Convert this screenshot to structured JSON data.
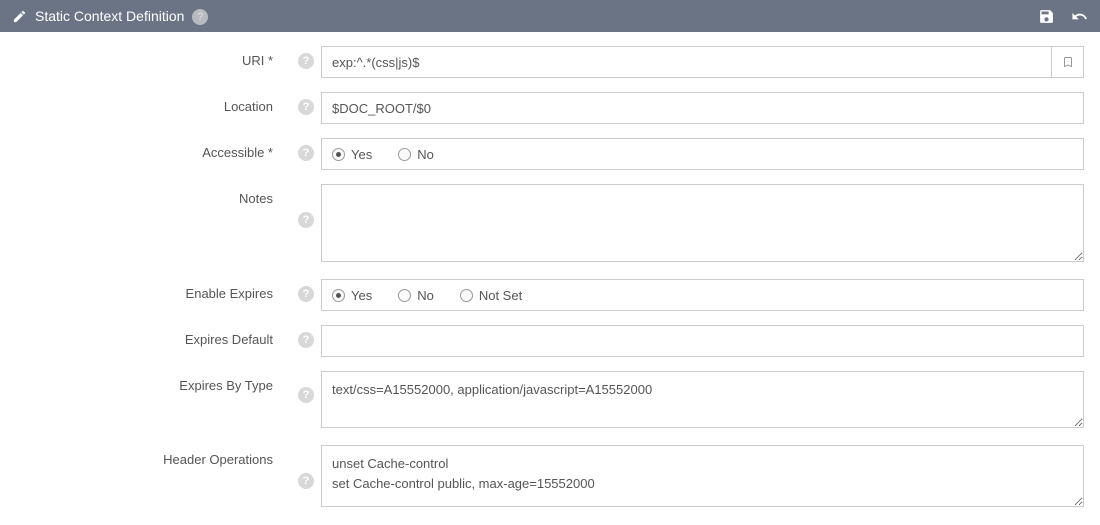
{
  "header": {
    "title": "Static Context Definition"
  },
  "labels": {
    "uri": "URI *",
    "location": "Location",
    "accessible": "Accessible *",
    "notes": "Notes",
    "enable_expires": "Enable Expires",
    "expires_default": "Expires Default",
    "expires_by_type": "Expires By Type",
    "header_operations": "Header Operations"
  },
  "fields": {
    "uri": "exp:^.*(css|js)$",
    "location": "$DOC_ROOT/$0",
    "notes": "",
    "expires_default": "",
    "expires_by_type": "text/css=A15552000, application/javascript=A15552000",
    "header_operations": "unset Cache-control\nset Cache-control public, max-age=15552000"
  },
  "radios": {
    "yes": "Yes",
    "no": "No",
    "not_set": "Not Set",
    "accessible_selected": "yes",
    "enable_expires_selected": "yes"
  }
}
